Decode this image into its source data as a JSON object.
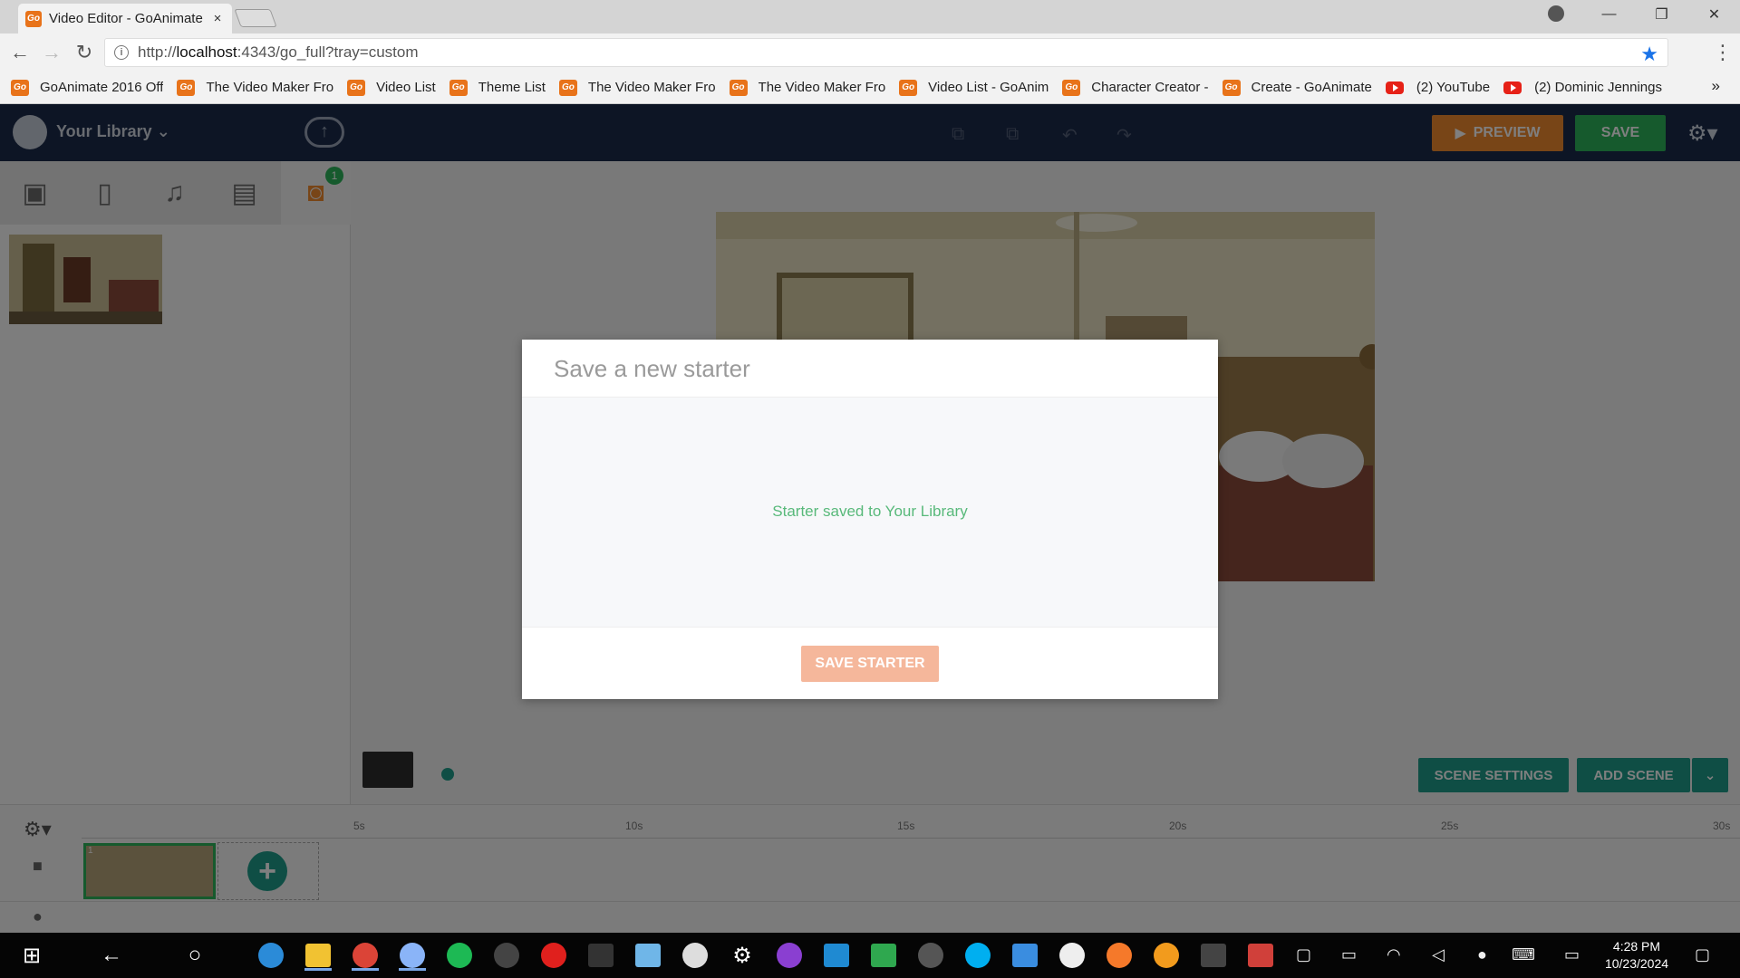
{
  "browser": {
    "tab_title": "Video Editor - GoAnimate",
    "tab_close": "×",
    "url_prefix": "http://",
    "url_host": "localhost",
    "url_rest": ":4343/go_full?tray=custom",
    "favicon_text": "Go",
    "bookmarks": [
      {
        "label": "GoAnimate 2016 Off",
        "icon": "go"
      },
      {
        "label": "The Video Maker Fro",
        "icon": "go"
      },
      {
        "label": "Video List",
        "icon": "go"
      },
      {
        "label": "Theme List",
        "icon": "go"
      },
      {
        "label": "The Video Maker Fro",
        "icon": "go"
      },
      {
        "label": "The Video Maker Fro",
        "icon": "go"
      },
      {
        "label": "Video List - GoAnim",
        "icon": "go"
      },
      {
        "label": "Character Creator -",
        "icon": "go"
      },
      {
        "label": "Create - GoAnimate",
        "icon": "go"
      },
      {
        "label": "(2) YouTube",
        "icon": "youtube"
      },
      {
        "label": "(2) Dominic Jennings",
        "icon": "youtube"
      }
    ],
    "bookmarks_more": "»"
  },
  "app": {
    "library_title": "Your Library",
    "preview_label": "PREVIEW",
    "save_label": "SAVE",
    "tray_badge": "1",
    "scene_settings_label": "SCENE SETTINGS",
    "add_scene_label": "ADD SCENE",
    "timeline_ticks": [
      "5s",
      "10s",
      "15s",
      "20s",
      "25s",
      "30s"
    ],
    "scene_number": "1"
  },
  "modal": {
    "title": "Save a new starter",
    "message": "Starter saved to Your Library",
    "button_label": "SAVE STARTER"
  },
  "taskbar": {
    "time": "4:28 PM",
    "date": "10/23/2024"
  },
  "colors": {
    "app_header": "#1a2a4a",
    "accent_orange": "#f08a2f",
    "accent_green": "#2cb45a",
    "teal": "#1e9d8a",
    "modal_button": "#f5b79b",
    "success_text": "#58b97a"
  }
}
